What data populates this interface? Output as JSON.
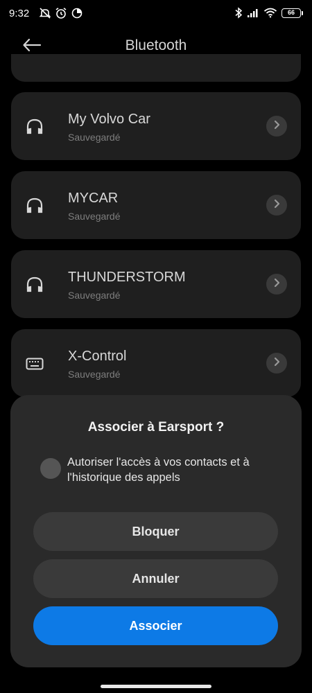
{
  "status_bar": {
    "time": "9:32",
    "battery": "66",
    "left_icons": [
      "silent-icon",
      "alarm-icon",
      "data-saver-icon"
    ],
    "right_icons": [
      "bluetooth-icon",
      "signal-icon",
      "wifi-icon",
      "battery-icon"
    ]
  },
  "header": {
    "title": "Bluetooth",
    "back_icon": "arrow-left-icon"
  },
  "devices": [
    {
      "name": "My Volvo Car",
      "status": "Sauvegardé",
      "icon": "headset-icon"
    },
    {
      "name": "MYCAR",
      "status": "Sauvegardé",
      "icon": "headset-icon"
    },
    {
      "name": "THUNDERSTORM",
      "status": "Sauvegardé",
      "icon": "headset-icon"
    },
    {
      "name": "X-Control",
      "status": "Sauvegardé",
      "icon": "keyboard-icon"
    }
  ],
  "dialog": {
    "title": "Associer à Earsport ?",
    "permission_text": "Autoriser l'accès à vos contacts et à l'historique des appels",
    "permission_checked": false,
    "buttons": {
      "block": "Bloquer",
      "cancel": "Annuler",
      "pair": "Associer"
    }
  },
  "colors": {
    "background": "#000000",
    "card": "#1f1f1f",
    "dialog": "#2a2a2a",
    "button": "#3a3a3a",
    "accent": "#0d7ae6"
  }
}
